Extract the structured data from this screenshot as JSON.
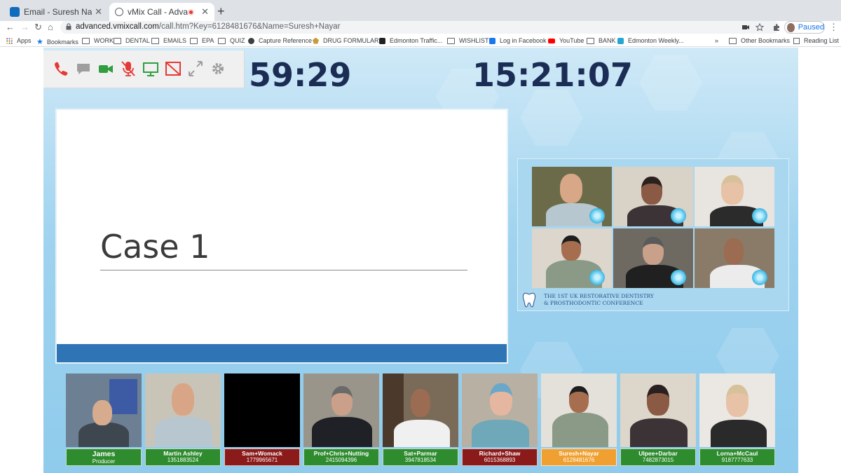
{
  "browser": {
    "tabs": [
      {
        "title": "Email - Suresh Nayar - Outlook",
        "active": false
      },
      {
        "title": "vMix Call - Advanced",
        "active": true
      }
    ],
    "url_host": "advanced.vmixcall.com",
    "url_path": "/call.htm?Key=6128481676&Name=Suresh+Nayar",
    "profile_label": "Paused",
    "bookmarks": [
      {
        "label": "Apps",
        "icon": "apps-grid-icon"
      },
      {
        "label": "Bookmarks",
        "icon": "star-icon"
      },
      {
        "label": "WORK",
        "icon": "folder-icon"
      },
      {
        "label": "DENTAL",
        "icon": "folder-icon"
      },
      {
        "label": "EMAILS",
        "icon": "folder-icon"
      },
      {
        "label": "EPA",
        "icon": "folder-icon"
      },
      {
        "label": "QUIZ",
        "icon": "folder-icon"
      },
      {
        "label": "Capture Reference",
        "icon": "globe-icon"
      },
      {
        "label": "DRUG FORMULAR...",
        "icon": "leaf-icon"
      },
      {
        "label": "Edmonton Traffic...",
        "icon": "site-icon"
      },
      {
        "label": "WISHLIST",
        "icon": "folder-icon"
      },
      {
        "label": "Log in Facebook",
        "icon": "facebook-icon"
      },
      {
        "label": "YouTube",
        "icon": "youtube-icon"
      },
      {
        "label": "BANK",
        "icon": "folder-icon"
      },
      {
        "label": "Edmonton Weekly...",
        "icon": "site-icon"
      }
    ],
    "overflow_label": "»",
    "other_bookmarks": "Other Bookmarks",
    "reading_list": "Reading List"
  },
  "call": {
    "controls": [
      "hangup-icon",
      "chat-icon",
      "camera-icon",
      "mic-muted-icon",
      "screen-share-icon",
      "screen-off-icon",
      "fullscreen-icon",
      "settings-gear-icon"
    ],
    "timer_left": "59:29",
    "timer_right": "15:21:07",
    "slide": {
      "title": "Case 1"
    },
    "conference": {
      "line1": "THE 1ST UK RESTORATIVE DENTISTRY",
      "line2": "& PROSTHODONTIC CONFERENCE"
    },
    "participants": [
      {
        "name": "James",
        "number": "Producer",
        "status": "green"
      },
      {
        "name": "Martin Ashley",
        "number": "1351883524",
        "status": "green"
      },
      {
        "name": "Sam+Womack",
        "number": "1779965671",
        "status": "red"
      },
      {
        "name": "Prof+Chris+Nutting",
        "number": "2415094396",
        "status": "green"
      },
      {
        "name": "Sat+Parmar",
        "number": "3947818534",
        "status": "green"
      },
      {
        "name": "Richard+Shaw",
        "number": "6015368893",
        "status": "red"
      },
      {
        "name": "Suresh+Nayar",
        "number": "6128481676",
        "status": "orange"
      },
      {
        "name": "Ulpee+Darbar",
        "number": "7482873015",
        "status": "green"
      },
      {
        "name": "Lorna+McCaul",
        "number": "9187777633",
        "status": "green"
      }
    ]
  }
}
